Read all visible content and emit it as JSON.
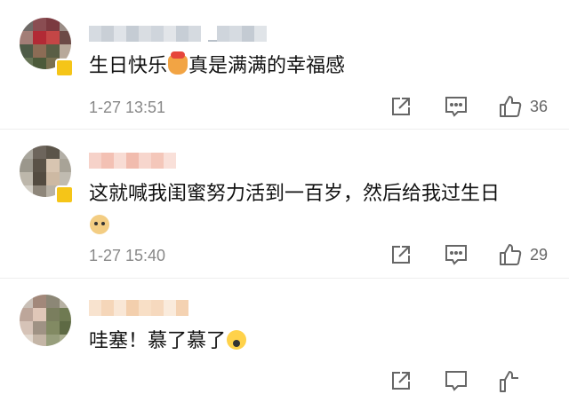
{
  "comments": [
    {
      "text": "生日快乐",
      "text2": "真是满满的幸福感",
      "emoji": "cake-emoji",
      "time": "1-27 13:51",
      "likes": "36"
    },
    {
      "text": "这就喊我闺蜜努力活到一百岁，然后给我过生日",
      "emoji": "doge-emoji",
      "time": "1-27 15:40",
      "likes": "29"
    },
    {
      "text": "哇塞！慕了慕了",
      "emoji": "scream-emoji"
    }
  ],
  "icons": {
    "share": "share-icon",
    "comment": "comment-icon",
    "like": "thumbs-up-icon"
  },
  "colors": {
    "text": "#111111",
    "meta": "#888888",
    "icon": "#666666",
    "divider": "#eeeeee"
  }
}
